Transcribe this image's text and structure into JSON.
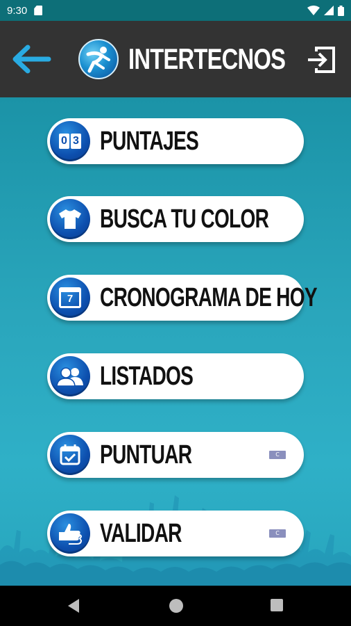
{
  "status_bar": {
    "time": "9:30",
    "icons": [
      "sd-card-icon",
      "wifi-icon",
      "signal-icon",
      "battery-icon"
    ]
  },
  "app_bar": {
    "title": "INTERTECNOS",
    "back_icon": "back-arrow-icon",
    "logo_icon": "runner-logo-icon",
    "logout_icon": "logout-icon"
  },
  "menu": [
    {
      "label": "PUNTAJES",
      "icon": "scoreboard-icon",
      "badge": ""
    },
    {
      "label": "BUSCA TU COLOR",
      "icon": "tshirt-icon",
      "badge": ""
    },
    {
      "label": "CRONOGRAMA DE HOY",
      "icon": "calendar-icon",
      "badge": ""
    },
    {
      "label": "LISTADOS",
      "icon": "group-icon",
      "badge": ""
    },
    {
      "label": "PUNTUAR",
      "icon": "calendar-check-icon",
      "badge": "C"
    },
    {
      "label": "VALIDAR",
      "icon": "thumbs-icon",
      "badge": "C"
    }
  ],
  "scoreboard_digits": [
    "0",
    "3"
  ],
  "calendar_day": "7",
  "colors": {
    "app_bar": "#333333",
    "accent": "#29abe2",
    "background": "#2aa6bc",
    "button_icon": "#0d4fae"
  }
}
